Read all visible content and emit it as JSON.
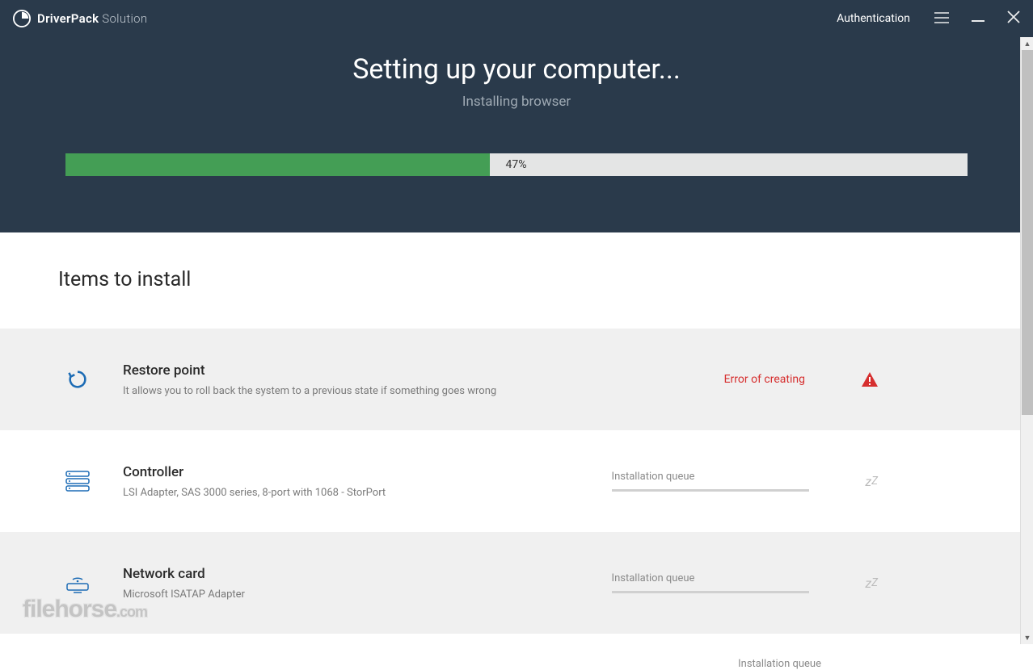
{
  "header": {
    "brand_bold": "DriverPack",
    "brand_light": " Solution",
    "auth": "Authentication"
  },
  "hero": {
    "title": "Setting up your computer...",
    "subtitle": "Installing browser",
    "progress_percent": 47,
    "progress_label": "47%"
  },
  "section_title": "Items to install",
  "items": [
    {
      "icon": "restore",
      "title": "Restore point",
      "desc": "It allows you to roll back the system to a previous state if something goes wrong",
      "status_type": "error",
      "status_text": "Error of creating"
    },
    {
      "icon": "controller",
      "title": "Controller",
      "desc": "LSI Adapter, SAS 3000 series, 8-port with 1068 - StorPort",
      "status_type": "queue",
      "status_text": "Installation queue"
    },
    {
      "icon": "network",
      "title": "Network card",
      "desc": "Microsoft ISATAP Adapter",
      "status_type": "queue",
      "status_text": "Installation queue"
    },
    {
      "icon": "network",
      "title": "",
      "desc": "",
      "status_type": "queue",
      "status_text": "Installation queue"
    }
  ],
  "watermark": "filehorse",
  "watermark_suffix": ".com"
}
